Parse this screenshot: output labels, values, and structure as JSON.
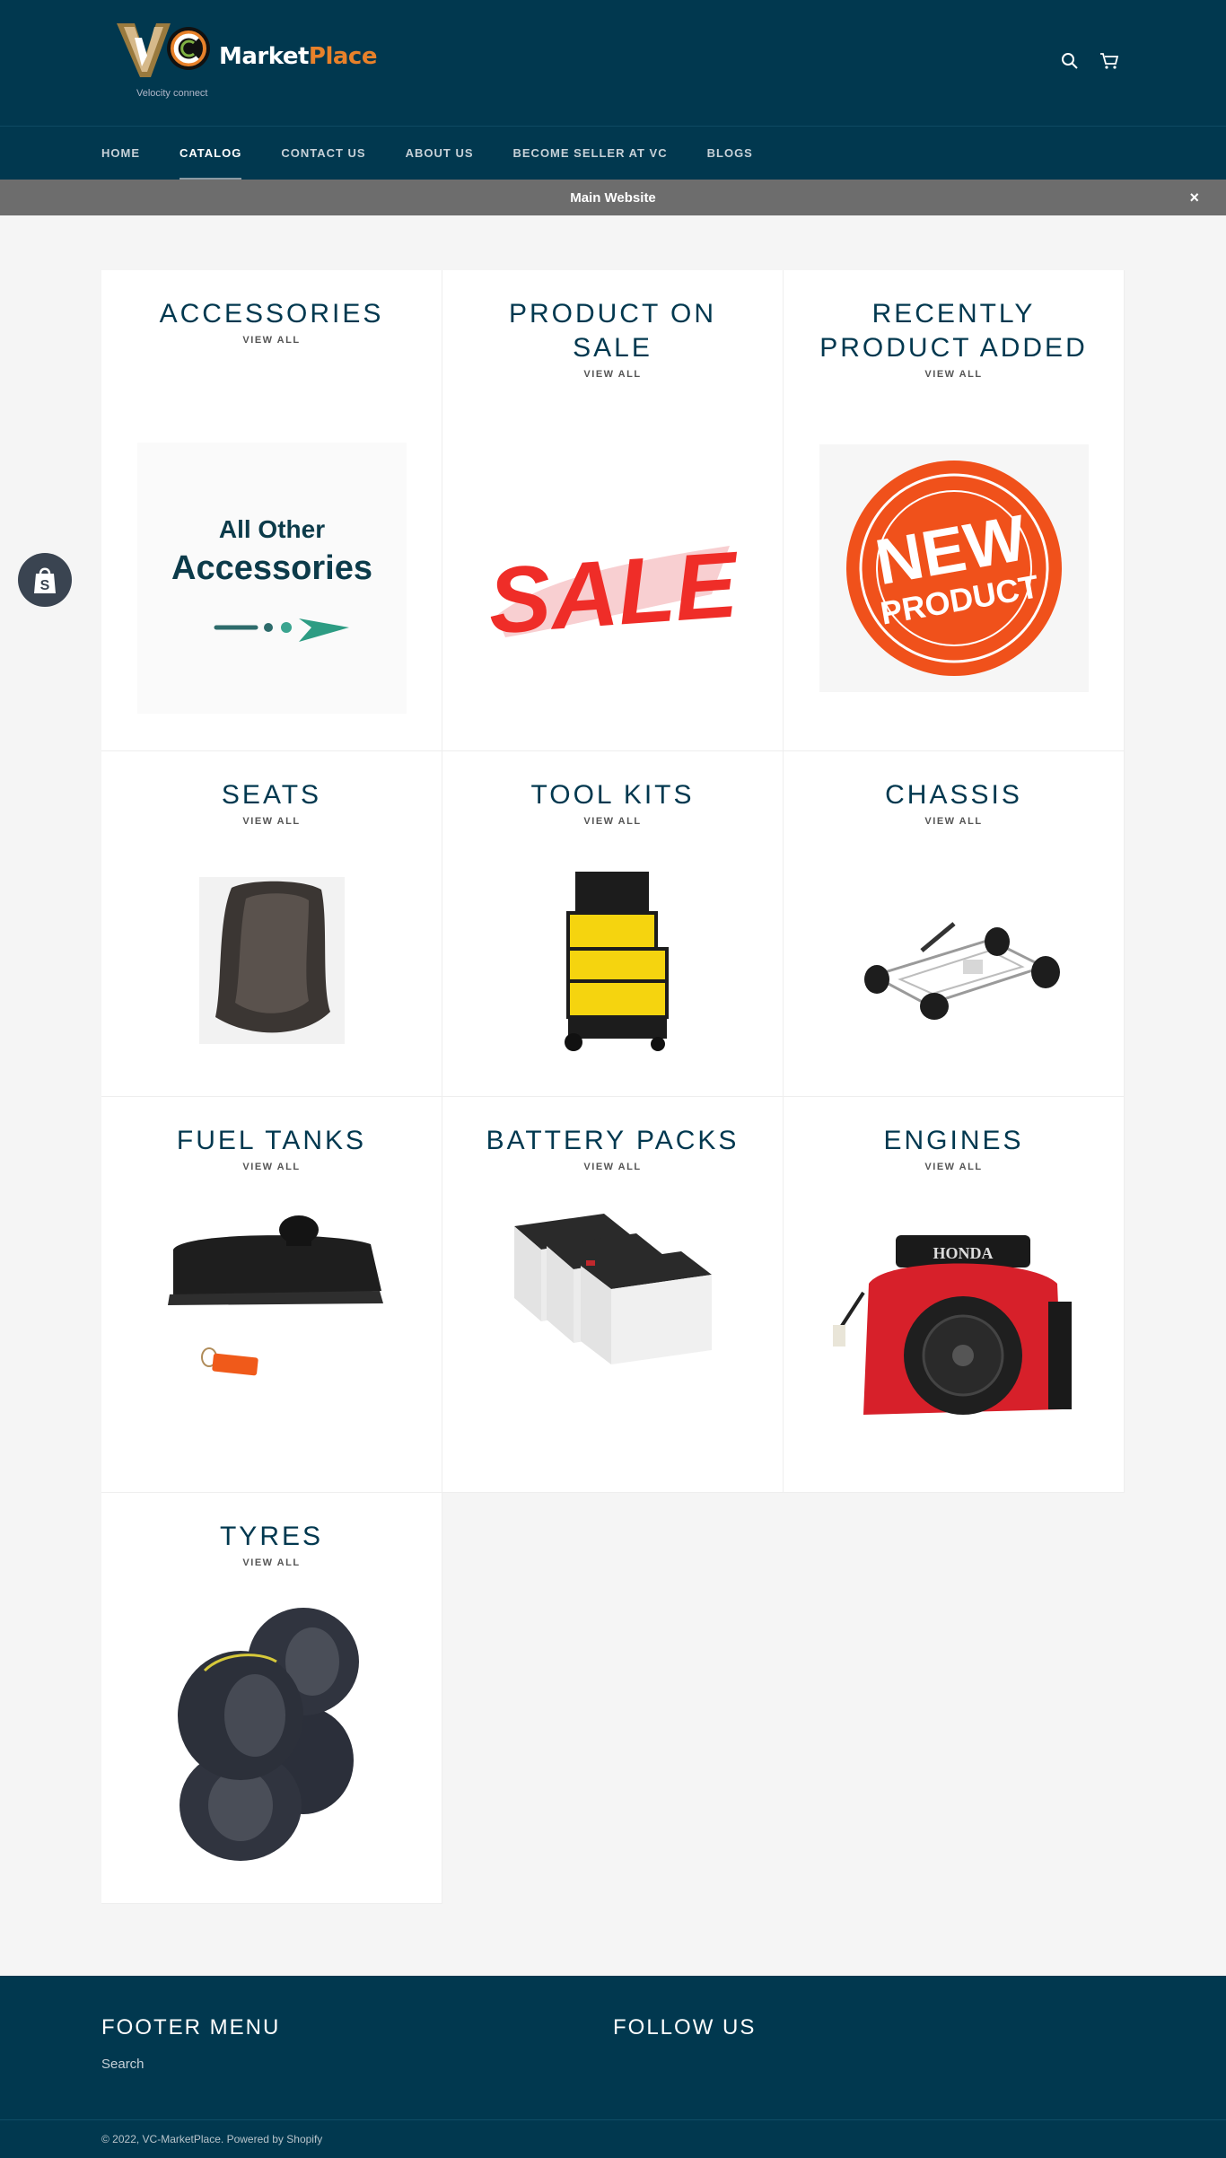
{
  "header": {
    "logo_brand_a": "Market",
    "logo_brand_b": "Place",
    "logo_tagline": "Velocity connect",
    "icons": [
      "search-icon",
      "cart-icon"
    ]
  },
  "nav": {
    "items": [
      {
        "label": "HOME",
        "active": false
      },
      {
        "label": "CATALOG",
        "active": true
      },
      {
        "label": "CONTACT US",
        "active": false
      },
      {
        "label": "ABOUT US",
        "active": false
      },
      {
        "label": "BECOME SELLER AT VC",
        "active": false
      },
      {
        "label": "BLOGS",
        "active": false
      }
    ]
  },
  "announcement": {
    "text": "Main Website",
    "close": "×"
  },
  "collections": [
    {
      "title": "ACCESSORIES",
      "link": "VIEW ALL",
      "image_texts": [
        "All Other",
        "Accessories"
      ]
    },
    {
      "title": "PRODUCT ON SALE",
      "link": "VIEW ALL",
      "image_texts": [
        "SALE"
      ]
    },
    {
      "title": "RECENTLY PRODUCT ADDED",
      "link": "VIEW ALL",
      "image_texts": [
        "NEW",
        "PRODUCT"
      ]
    },
    {
      "title": "SEATS",
      "link": "VIEW ALL"
    },
    {
      "title": "TOOL KITS",
      "link": "VIEW ALL"
    },
    {
      "title": "CHASSIS",
      "link": "VIEW ALL"
    },
    {
      "title": "FUEL TANKS",
      "link": "VIEW ALL"
    },
    {
      "title": "BATTERY PACKS",
      "link": "VIEW ALL"
    },
    {
      "title": "ENGINES",
      "link": "VIEW ALL",
      "image_texts": [
        "HONDA"
      ]
    },
    {
      "title": "TYRES",
      "link": "VIEW ALL"
    }
  ],
  "footer": {
    "menu_title": "FOOTER MENU",
    "menu_items": [
      "Search"
    ],
    "follow_title": "FOLLOW US",
    "copyright": "© 2022, VC-MarketPlace. Powered by Shopify"
  },
  "colors": {
    "header_bg": "#01384f",
    "announcement_bg": "#6d6d6d",
    "title": "#01384f",
    "logo_accent": "#e8812a"
  }
}
